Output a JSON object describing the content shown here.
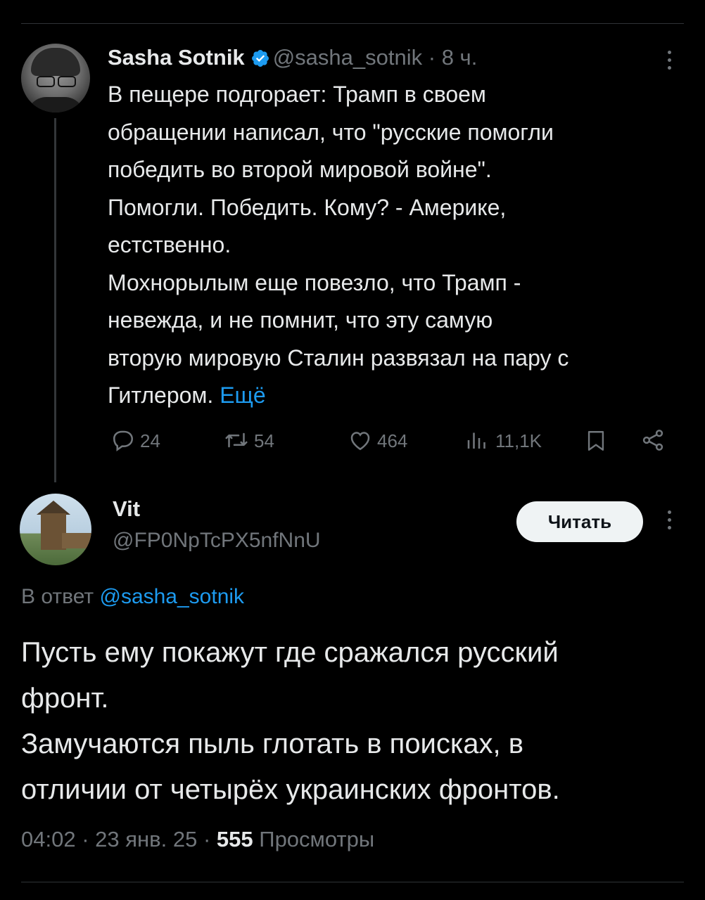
{
  "tweet1": {
    "author_name": "Sasha Sotnik",
    "handle": "@sasha_sotnik",
    "separator": "·",
    "time": "8 ч.",
    "text_lines": [
      "В пещере подгорает: Трамп в своем",
      "обращении написал, что \"русские помогли",
      "победить во второй мировой войне\".",
      "Помогли. Победить. Кому? - Америке,",
      "естственно.",
      "Мохнорылым еще повезло, что Трамп -",
      "невежда, и не помнит, что эту самую",
      "вторую мировую Сталин развязал на пару с",
      "Гитлером."
    ],
    "more_link": "Ещё",
    "stats": {
      "replies": "24",
      "retweets": "54",
      "likes": "464",
      "views": "11,1K"
    },
    "icons": [
      "verified-badge-icon",
      "more-options-icon",
      "reply-icon",
      "retweet-icon",
      "like-icon",
      "views-icon",
      "bookmark-icon",
      "share-icon"
    ]
  },
  "tweet2": {
    "author_name": "Vit",
    "handle": "@FP0NpTcPX5nfNnU",
    "follow_label": "Читать",
    "reply_prefix": "В ответ",
    "reply_handle": "@sasha_sotnik",
    "text_lines": [
      "Пусть ему покажут где сражался русский",
      "фронт.",
      "Замучаются пыль глотать в поисках, в",
      "отличии от четырёх украинских фронтов."
    ],
    "time": "04:02",
    "date": "23 янв. 25",
    "views_count": "555",
    "views_label": "Просмотры",
    "separator": "·"
  },
  "colors": {
    "background": "#000000",
    "text": "#e7e9ea",
    "secondary": "#71767b",
    "link": "#1d9bf0",
    "button_bg": "#eff3f4"
  }
}
